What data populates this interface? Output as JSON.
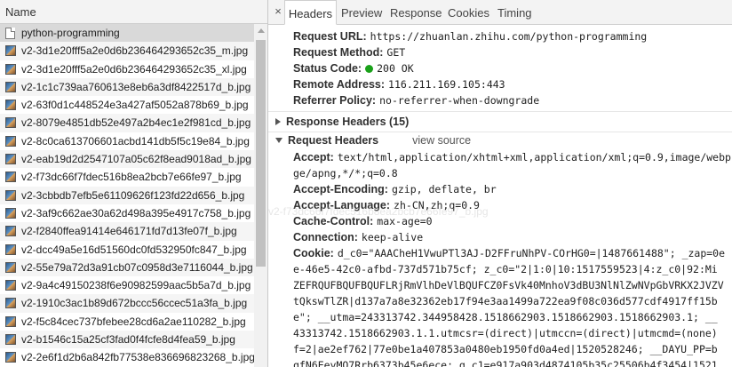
{
  "list": {
    "column_header": "Name",
    "items": [
      {
        "name": "python-programming",
        "icon": "document-icon"
      },
      {
        "name": "v2-3d1e20fff5a2e0d6b236464293652c35_m.jpg",
        "icon": "image-icon"
      },
      {
        "name": "v2-3d1e20fff5a2e0d6b236464293652c35_xl.jpg",
        "icon": "image-icon"
      },
      {
        "name": "v2-1c1c739aa760613e8eb6a3df8422517d_b.jpg",
        "icon": "image-icon"
      },
      {
        "name": "v2-63f0d1c448524e3a427af5052a878b69_b.jpg",
        "icon": "image-icon"
      },
      {
        "name": "v2-8079e4851db52e497a2b4ec1e2f981cd_b.jpg",
        "icon": "image-icon"
      },
      {
        "name": "v2-8c0ca613706601acbd141db5f5c19e84_b.jpg",
        "icon": "image-icon"
      },
      {
        "name": "v2-eab19d2d2547107a05c62f8ead9018ad_b.jpg",
        "icon": "image-icon"
      },
      {
        "name": "v2-f73dc66f7fdec516b8ea2bcb7e66fe97_b.jpg",
        "icon": "image-icon"
      },
      {
        "name": "v2-3cbbdb7efb5e61109626f123fd22d656_b.jpg",
        "icon": "image-icon"
      },
      {
        "name": "v2-3af9c662ae30a62d498a395e4917c758_b.jpg",
        "icon": "image-icon"
      },
      {
        "name": "v2-f2840ffea91414e646171fd7d13fe07f_b.jpg",
        "icon": "image-icon"
      },
      {
        "name": "v2-dcc49a5e16d51560dc0fd532950fc847_b.jpg",
        "icon": "image-icon"
      },
      {
        "name": "v2-55e79a72d3a91cb07c0958d3e7116044_b.jpg",
        "icon": "image-icon"
      },
      {
        "name": "v2-9a4c49150238f6e90982599aac5b5a7d_b.jpg",
        "icon": "image-icon"
      },
      {
        "name": "v2-1910c3ac1b89d672bccc56ccec51a3fa_b.jpg",
        "icon": "image-icon"
      },
      {
        "name": "v2-f5c84cec737bfebee28cd6a2ae110282_b.jpg",
        "icon": "image-icon"
      },
      {
        "name": "v2-b1546c15a25cf3fad0f4fcfe8d4fea59_b.jpg",
        "icon": "image-icon"
      },
      {
        "name": "v2-2e6f1d2b6a842fb77538e836696823268_b.jpg",
        "icon": "image-icon"
      }
    ]
  },
  "tabs": {
    "close_glyph": "×",
    "headers": "Headers",
    "preview": "Preview",
    "response": "Response",
    "cookies": "Cookies",
    "timing": "Timing"
  },
  "general": {
    "url_key": "Request URL:",
    "url_val": "https://zhuanlan.zhihu.com/python-programming",
    "method_key": "Request Method:",
    "method_val": "GET",
    "status_key": "Status Code:",
    "status_val": "200 OK",
    "status_color": "#1aa11a",
    "remote_key": "Remote Address:",
    "remote_val": "116.211.169.105:443",
    "referrer_key": "Referrer Policy:",
    "referrer_val": "no-referrer-when-downgrade"
  },
  "response_headers": {
    "title": "Response Headers (15)"
  },
  "request_headers": {
    "title": "Request Headers",
    "view_source": "view source",
    "accept_key": "Accept:",
    "accept_val": "text/html,application/xhtml+xml,application/xml;q=0.9,image/webp,image/apng,*/*;q=0.8",
    "accept_line1": "text/html,application/xhtml+xml,application/xml;q=0.9,image/webp,ima",
    "accept_line2": "ge/apng,*/*;q=0.8",
    "encoding_key": "Accept-Encoding:",
    "encoding_val": "gzip, deflate, br",
    "language_key": "Accept-Language:",
    "language_val": "zh-CN,zh;q=0.9",
    "cache_key": "Cache-Control:",
    "cache_val": "max-age=0",
    "connection_key": "Connection:",
    "connection_val": "keep-alive",
    "cookie_key": "Cookie:",
    "cookie_lines": [
      "d_c0=\"AAACheH1VwuPTl3AJ-D2FFruNhPV-COrHG0=|1487661488\"; _zap=0e",
      "e-46e5-42c0-afbd-737d571b75cf; z_c0=\"2|1:0|10:1517559523|4:z_c0|92:Mi",
      "ZEFRQUFBQUFBQUFLRjRmVlhDeVlBQUFCZ0FsVk40MnhoV3dBU3NlNlZwNVpGbVRKX2JVZV",
      "tQkswTlZR|d137a7a8e32362eb17f94e3aa1499a722ea9f08c036d577cdf4917ff15b",
      "e\"; __utma=243313742.344958428.1518662903.1518662903.1518662903.1; __",
      "43313742.1518662903.1.1.utmcsr=(direct)|utmccn=(direct)|utmcmd=(none)",
      "f=2|ae2ef762|77e0be1a407853a0480eb1950fd0a4ed|1520528246; __DAYU_PP=b",
      "qfN6EeyMQ7Rrb6373b45e6ece; q_c1=e917a903d4874105b35c25506b4f3454|1521"
    ]
  },
  "tooltip_ghost": "v2-f73dc66f7fdec516b8ea2bcb7e66fe97_b.jpg"
}
